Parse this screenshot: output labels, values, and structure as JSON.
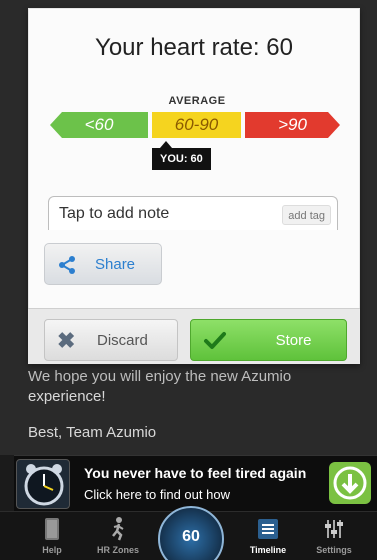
{
  "dialog": {
    "title": "Your heart rate: 60",
    "average_label": "AVERAGE",
    "ranges": [
      "<60",
      "60-90",
      ">90"
    ],
    "you_badge": "YOU: 60",
    "note_placeholder": "Tap to add note",
    "add_tag_label": "add tag",
    "share_label": "Share",
    "discard_label": "Discard",
    "store_label": "Store"
  },
  "background": {
    "message_fragment": "We hope you will enjoy the new Azumio",
    "message_line2": "experience!",
    "signoff": "Best, Team Azumio"
  },
  "ad": {
    "headline": "You never have to feel tired again",
    "subline": "Click here to find out how"
  },
  "nav": {
    "items": [
      "Help",
      "HR Zones",
      "Timeline",
      "Settings"
    ],
    "center_value": "60"
  },
  "colors": {
    "low": "#6cc24a",
    "mid": "#f5d41f",
    "high": "#e23a2e",
    "store": "#5fc23b",
    "share_text": "#2c7fcf"
  }
}
